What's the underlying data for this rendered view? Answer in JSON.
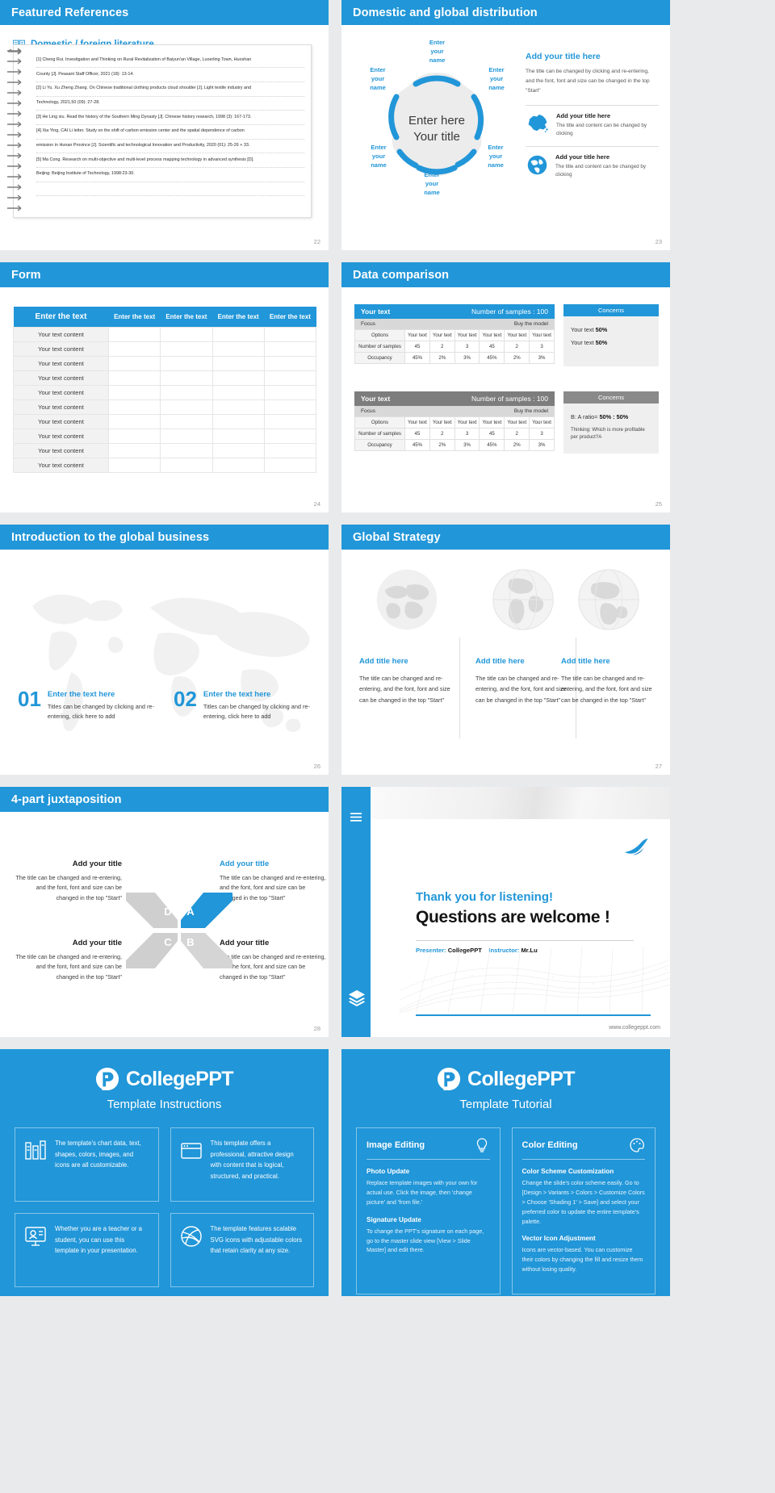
{
  "theme": {
    "accent": "#2196d8",
    "page_bg": "#e9eaec",
    "gray_header": "#7d7d7d"
  },
  "slides": {
    "references": {
      "title": "Featured References",
      "page": "22",
      "section_label": "Domestic / foreign literature",
      "section_icon": "book-icon",
      "entries": [
        "[1] Cheng Rui. Investigation and Thinking on Rural Revitalization of Baiyun'an Village, Luoerling Town, Huoshan",
        "County [J]. Peasant Staff Officer, 2021 (18): 13-14.",
        "[2] Li Yu. Xu Zheng Zhang. On Chinese traditional clothing products cloud shoulder [J]. Light textile industry and",
        "Technology, 2021,50 (09): 27-28.",
        "[3] He Ling xiu. Read the history of the Southern Ming Dynasty [J]. Chinese history research, 1998 (3): 167-173.",
        "[4] Xia Ying, CAI Li letter. Study on the shift of carbon emission center and the spatial dependence of carbon",
        "emission in Hunan Province [J]. Scientific and technological Innovation and Productivity, 2020 (01): 25-26 + 33.",
        "[5] Ma Cong. Research on multi-objective and multi-level process mapping technology in advanced synthesis [D].",
        "Beijing: Beijing Institute of Technology, 1998:23-30."
      ]
    },
    "distribution": {
      "title": "Domestic and global distribution",
      "page": "23",
      "center_line1": "Enter here",
      "center_line2": "Your title",
      "petals": [
        "Enter\nyour\nname",
        "Enter\nyour\nname",
        "Enter\nyour\nname",
        "Enter\nyour\nname",
        "Enter\nyour\nname",
        "Enter\nyour\nname"
      ],
      "panel": {
        "heading": "Add your title here",
        "body": "The title can be changed by clicking and re-entering, and the font, font and size can be changed in the top \"Start\"",
        "rows": [
          {
            "icon": "china-map-icon",
            "title": "Add your title here",
            "text": "The title and content can be changed by clicking"
          },
          {
            "icon": "globe-icon",
            "title": "Add your title here",
            "text": "The title and content can be changed by clicking"
          }
        ]
      }
    },
    "form": {
      "title": "Form",
      "page": "24",
      "columns": [
        "Enter the text",
        "Enter the text",
        "Enter the text",
        "Enter the text",
        "Enter the text"
      ],
      "rows": [
        "Your text content",
        "Your text content",
        "Your text content",
        "Your text content",
        "Your text content",
        "Your text content",
        "Your text content",
        "Your text content",
        "Your text content",
        "Your text content"
      ]
    },
    "data_comparison": {
      "title": "Data comparison",
      "page": "25",
      "tables": [
        {
          "head_left": "Your text",
          "head_right": "Number of samples : 100",
          "sub_left": "Focus",
          "sub_right": "Buy the model",
          "row_labels": [
            "Options",
            "Number of samples",
            "Occupancy"
          ],
          "options": [
            "Your text",
            "Your text",
            "Your text",
            "Your text",
            "Your text",
            "Your text"
          ],
          "samples": [
            "45",
            "2",
            "3",
            "45",
            "2",
            "3"
          ],
          "occupancy": [
            "45%",
            "2%",
            "3%",
            "45%",
            "2%",
            "3%"
          ]
        },
        {
          "head_left": "Your text",
          "head_right": "Number of samples : 100",
          "sub_left": "Focus",
          "sub_right": "Buy the model",
          "row_labels": [
            "Options",
            "Number of samples",
            "Occupancy"
          ],
          "options": [
            "Your text",
            "Your text",
            "Your text",
            "Your text",
            "Your text",
            "Your text"
          ],
          "samples": [
            "45",
            "2",
            "3",
            "45",
            "2",
            "3"
          ],
          "occupancy": [
            "45%",
            "2%",
            "3%",
            "45%",
            "2%",
            "3%"
          ]
        }
      ],
      "concerns": [
        {
          "header": "Concerns",
          "line1_label": "Your text",
          "line1_value": "50%",
          "line2_label": "Your text",
          "line2_value": "50%"
        },
        {
          "header": "Concerns",
          "ratio_label": "B: A ratio=",
          "ratio_value": "50% : 50%",
          "note": "Thinking: Which is more profitable per product?A"
        }
      ]
    },
    "global_business": {
      "title": "Introduction to the global business",
      "page": "26",
      "items": [
        {
          "num": "01",
          "heading": "Enter the text here",
          "body": "Titles can be changed by clicking and re-entering, click here to add"
        },
        {
          "num": "02",
          "heading": "Enter the text here",
          "body": "Titles can be changed by clicking and re-entering, click here to add"
        }
      ]
    },
    "global_strategy": {
      "title": "Global Strategy",
      "page": "27",
      "columns": [
        {
          "icon": "globe-flat-icon",
          "heading": "Add title here",
          "body": "The title can be changed and re-entering, and the font, font and size can be changed in the top \"Start\""
        },
        {
          "icon": "globe-americas-icon",
          "heading": "Add title here",
          "body": "The title can be changed and re-entering, and the font, font and size can be changed in the top \"Start\""
        },
        {
          "icon": "globe-asia-icon",
          "heading": "Add title here",
          "body": "The title can be changed and re-entering, and the font, font and size can be changed in the top \"Start\""
        }
      ]
    },
    "juxtaposition": {
      "title": "4-part juxtaposition",
      "page": "28",
      "center_letters": [
        "D",
        "A",
        "C",
        "B"
      ],
      "quadrants": [
        {
          "heading": "Add your title",
          "body": "The title can be changed and re-entering, and the font, font and size can be changed in the top \"Start\"",
          "accent": false
        },
        {
          "heading": "Add your title",
          "body": "The title can be changed and re-entering, and the font, font and size can be changed in the top \"Start\"",
          "accent": true
        },
        {
          "heading": "Add your title",
          "body": "The title can be changed and re-entering, and the font, font and size can be changed in the top \"Start\"",
          "accent": false
        },
        {
          "heading": "Add your title",
          "body": "The title can be changed and re-entering, and the font, font and size can be changed in the top \"Start\"",
          "accent": false
        }
      ]
    },
    "thank_you": {
      "headline": "Thank you for listening!",
      "subhead": "Questions are welcome !",
      "presenter_label": "Presenter:",
      "presenter_value": "CollegePPT",
      "instructor_label": "Instructor:",
      "instructor_value": "Mr.Lu",
      "url": "www.collegeppt.com"
    }
  },
  "instructions_panel": {
    "brand": "CollegePPT",
    "subtitle": "Template Instructions",
    "cards": [
      {
        "icon": "chart-data-icon",
        "text": "The template's chart data, text, shapes, colors, images, and icons are all customizable."
      },
      {
        "icon": "window-icon",
        "text": "This template offers a professional, attractive design with content that is logical, structured, and practical."
      },
      {
        "icon": "presenter-icon",
        "text": "Whether you are a teacher or a student, you can use this template in your presentation."
      },
      {
        "icon": "dribbble-icon",
        "text": "The template features scalable SVG icons with adjustable colors that retain clarity at any size."
      }
    ]
  },
  "tutorial_panel": {
    "brand": "CollegePPT",
    "subtitle": "Template Tutorial",
    "cards": [
      {
        "heading": "Image Editing",
        "icon": "lightbulb-icon",
        "sections": [
          {
            "title": "Photo Update",
            "text": "Replace template images with your own for actual use. Click the image, then 'change picture' and 'from file.'"
          },
          {
            "title": "Signature Update",
            "text": "To change the PPT's signature on each page, go to the master slide view [View > Slide Master] and edit there."
          }
        ]
      },
      {
        "heading": "Color Editing",
        "icon": "palette-icon",
        "sections": [
          {
            "title": "Color Scheme Customization",
            "text": "Change the slide's color scheme easily. Go to [Design > Variants > Colors > Customize Colors > Choose 'Shading 1' > Save] and select your preferred color to update the entire template's palette."
          },
          {
            "title": "Vector Icon Adjustment",
            "text": "Icons are vector-based. You can customize their colors by changing the fill and resize them without losing quality."
          }
        ]
      }
    ]
  }
}
